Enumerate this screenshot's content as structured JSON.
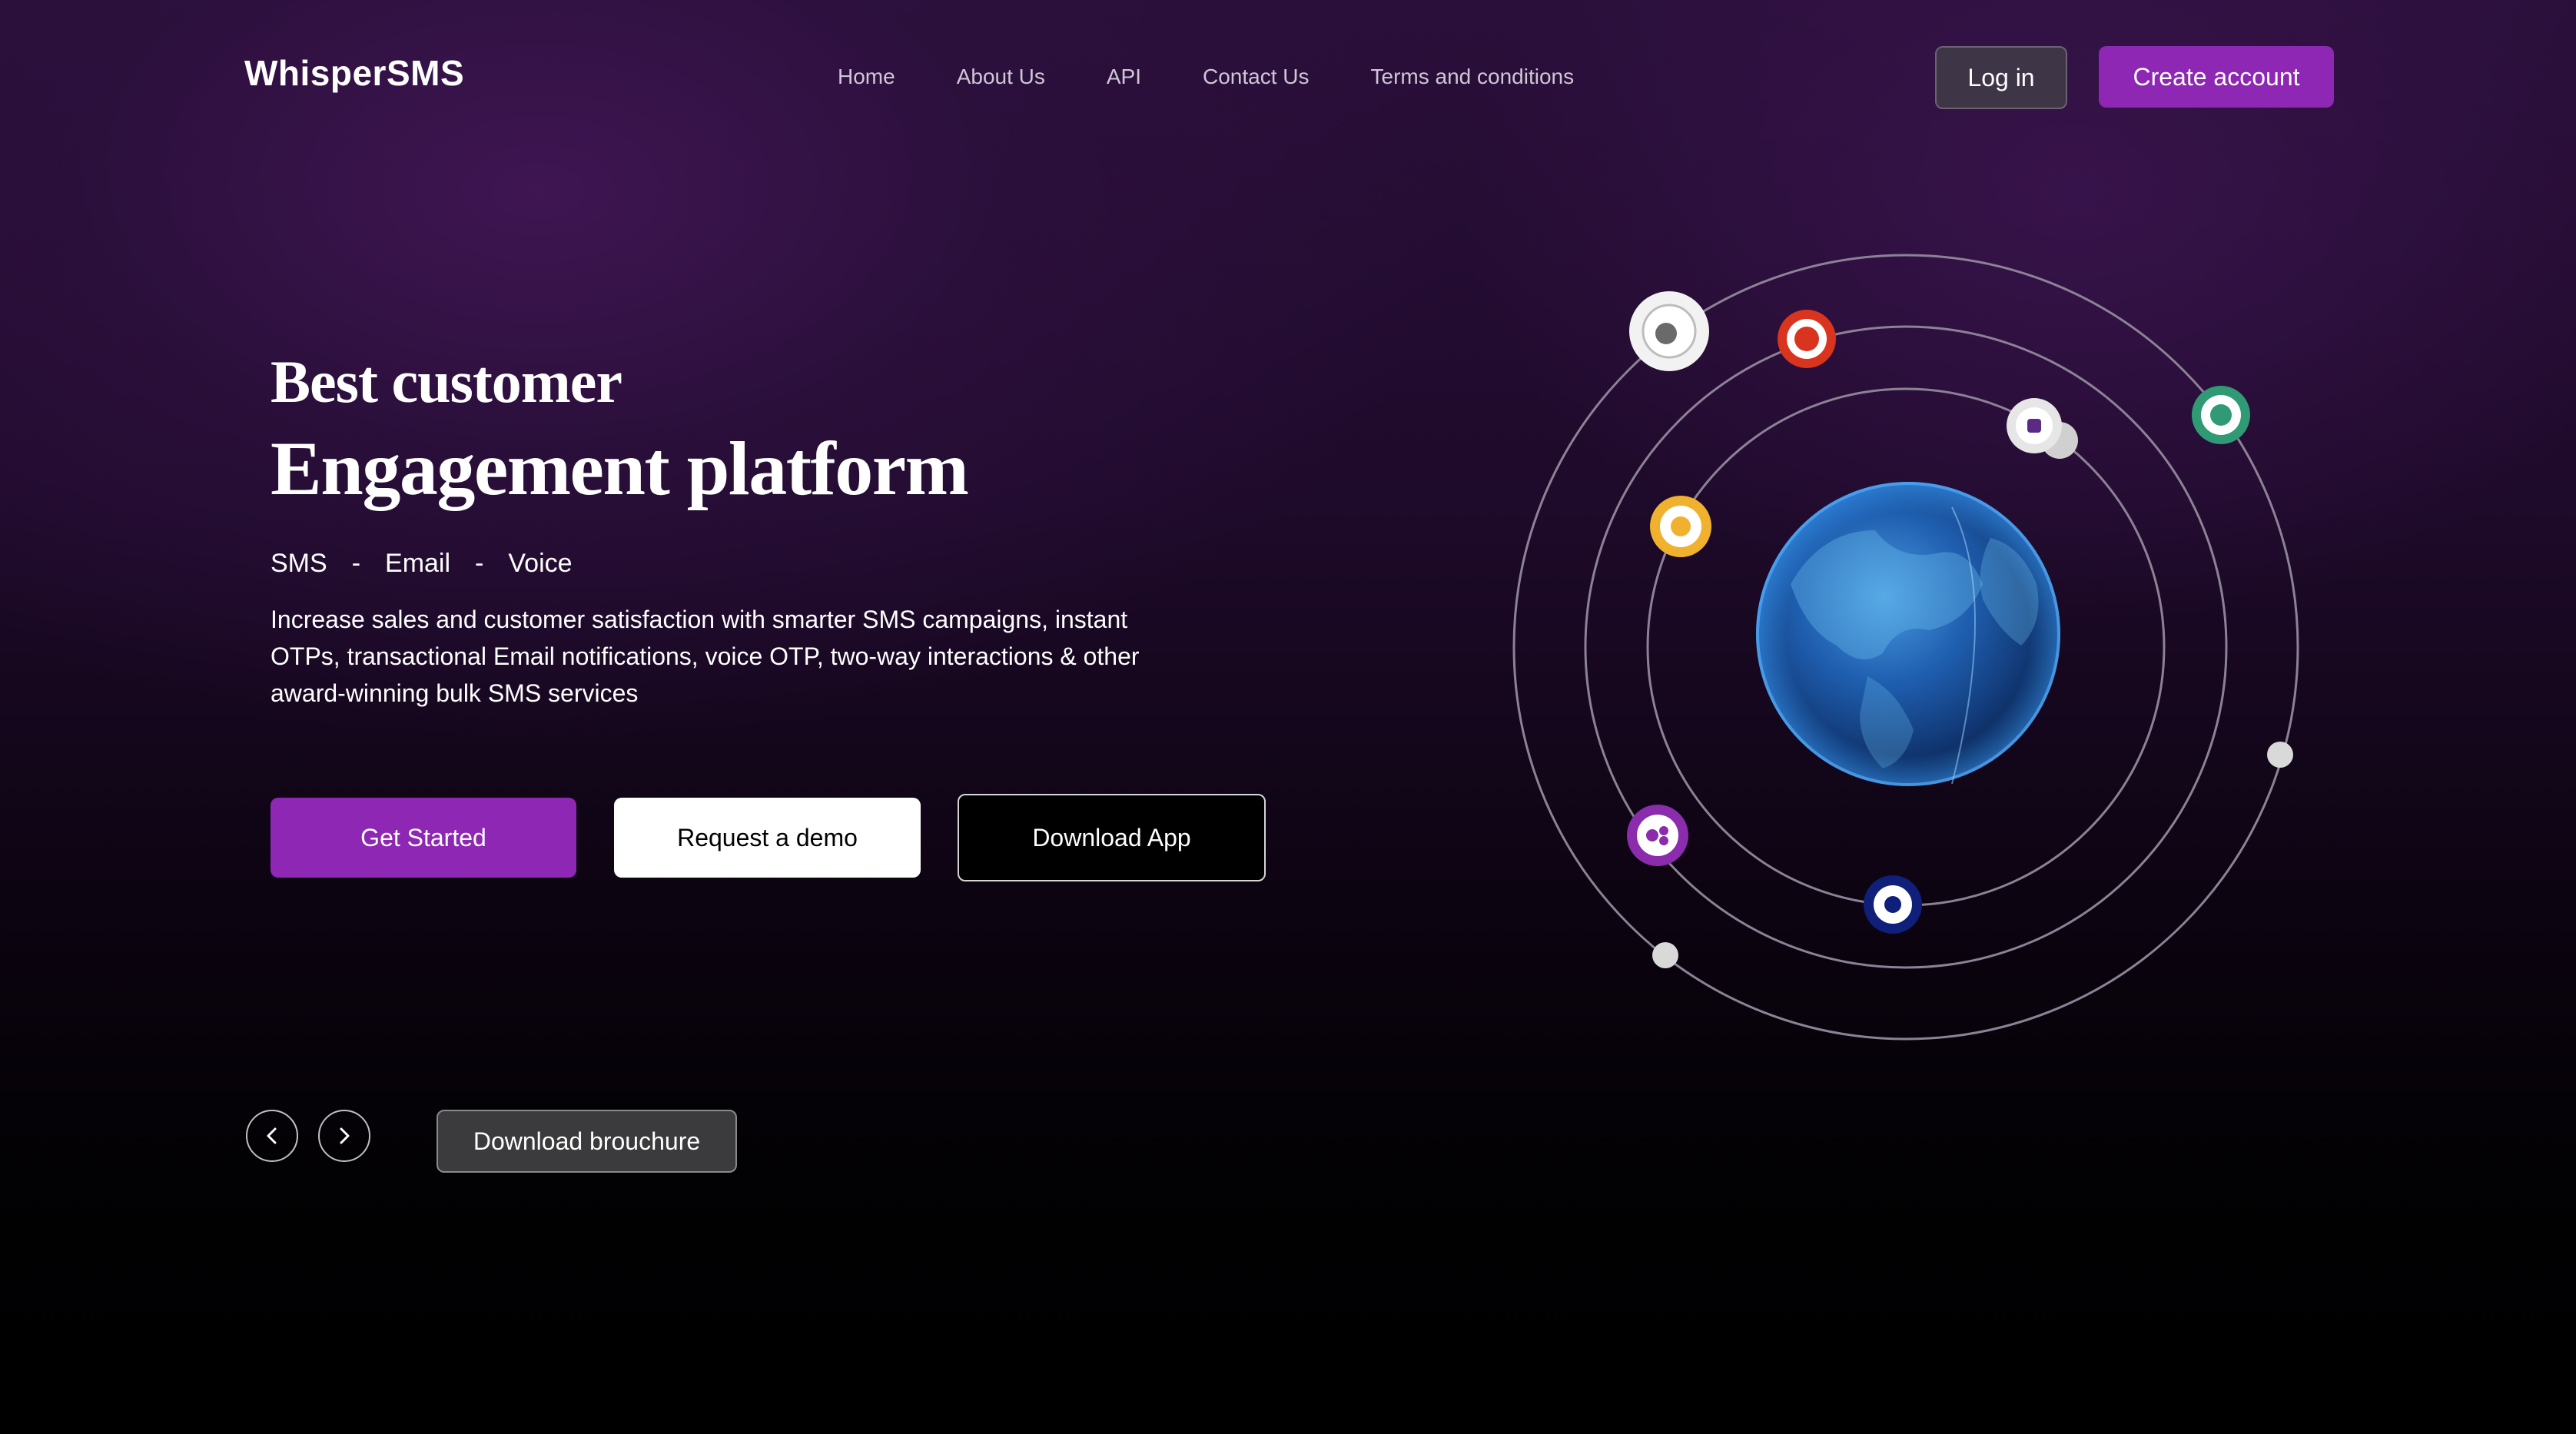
{
  "header": {
    "logo": "WhisperSMS",
    "nav": [
      "Home",
      "About Us",
      "API",
      "Contact Us",
      "Terms and conditions"
    ],
    "login_label": "Log in",
    "create_account_label": "Create account"
  },
  "hero": {
    "headline_line1": "Best customer",
    "headline_line2": "Engagement platform",
    "channels": [
      "SMS",
      "-",
      "Email",
      "-",
      "Voice"
    ],
    "description": "Increase sales and customer satisfaction with smarter SMS campaigns, instant OTPs, transactional Email notifications, voice OTP, two-way interactions & other award-winning bulk SMS services",
    "buttons": {
      "get_started": "Get Started",
      "request_demo": "Request a demo",
      "download_app": "Download App"
    }
  },
  "carousel": {
    "prev_icon": "chevron-left-icon",
    "next_icon": "chevron-right-icon",
    "brochure_label": "Download brouchure"
  },
  "illustration": {
    "center": "globe",
    "app_icons": [
      "app-icon-white",
      "app-icon-red",
      "app-icon-gray",
      "app-icon-green",
      "app-icon-yellow",
      "app-icon-purple",
      "app-icon-navy"
    ]
  },
  "colors": {
    "accent": "#8e27b3",
    "background_top": "#2a0f3a",
    "background_bottom": "#000000"
  }
}
